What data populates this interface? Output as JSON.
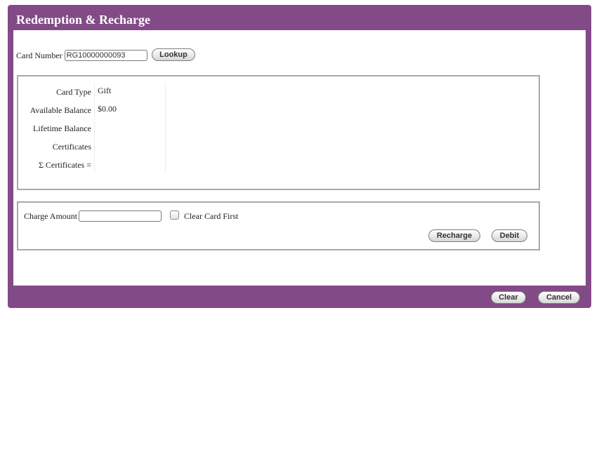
{
  "dialog": {
    "title": "Redemption & Recharge"
  },
  "lookup": {
    "card_number_label": "Card Number",
    "card_number_value": "RG10000000093",
    "lookup_button": "Lookup"
  },
  "card_info": {
    "card_type_label": "Card Type",
    "card_type_value": "Gift",
    "available_balance_label": "Available Balance",
    "available_balance_value": "$0.00",
    "lifetime_balance_label": "Lifetime Balance",
    "lifetime_balance_value": "",
    "certificates_label": "Certificates",
    "certificates_value": "",
    "total_certificates_label": "Σ Certificates =",
    "total_certificates_value": ""
  },
  "charge": {
    "charge_amount_label": "Charge Amount",
    "charge_amount_value": "",
    "clear_card_first_label": "Clear Card First",
    "recharge_button": "Recharge",
    "debit_button": "Debit"
  },
  "footer": {
    "clear_button": "Clear",
    "cancel_button": "Cancel"
  }
}
